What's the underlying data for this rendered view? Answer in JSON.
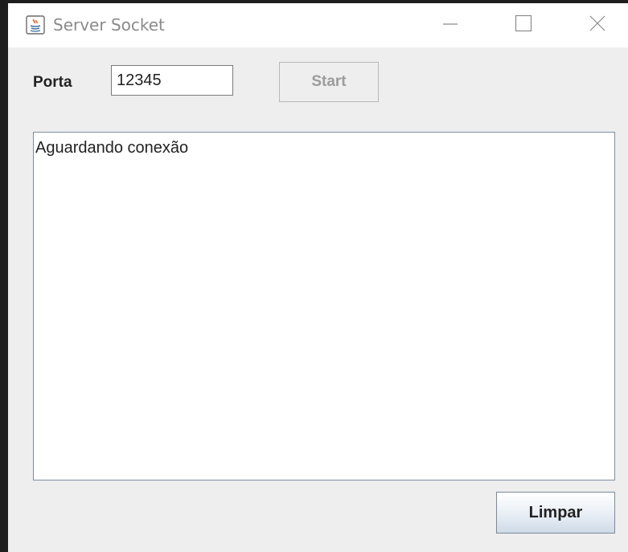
{
  "window": {
    "title": "Server Socket",
    "icon": "java-icon",
    "controls": {
      "minimize": "minimize-icon",
      "maximize": "maximize-icon",
      "close": "close-icon"
    }
  },
  "form": {
    "port_label": "Porta",
    "port_value": "12345",
    "start_label": "Start",
    "start_enabled": false
  },
  "log": {
    "text": "Aguardando conexão"
  },
  "actions": {
    "clear_label": "Limpar"
  },
  "colors": {
    "window_background": "#eeeeee",
    "titlebar_background": "#ffffff",
    "disabled_text": "#9c9c9c"
  }
}
